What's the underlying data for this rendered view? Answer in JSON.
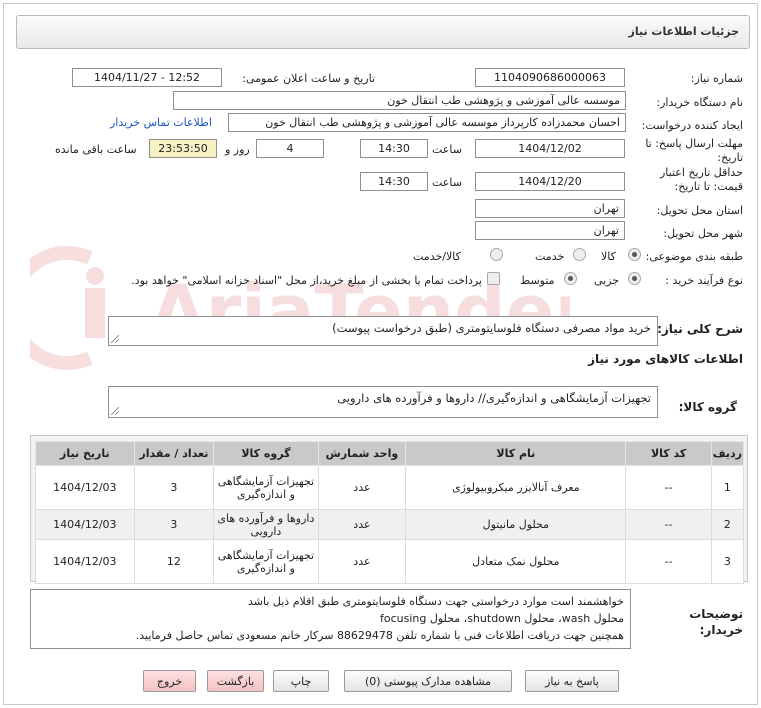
{
  "page": {
    "title": "جزئیات اطلاعات نیاز"
  },
  "form": {
    "need_number_label": "شماره نیاز:",
    "need_number": "1104090686000063",
    "announce_label": "تاریخ و ساعت اعلان عمومی:",
    "announce_value": "1404/11/27 - 12:52",
    "buyer_label": "نام دستگاه خریدار:",
    "buyer_value": "موسسه عالی آموزشی و پژوهشی طب انتقال خون",
    "creator_label": "ایجاد کننده درخواست:",
    "creator_value": "احسان محمدزاده کارپرداز موسسه عالی آموزشی و پژوهشی طب انتقال خون",
    "contact_link": "اطلاعات تماس خریدار",
    "deadline_label": "مهلت ارسال پاسخ: تا تاریخ:",
    "deadline_date": "1404/12/02",
    "time_label": "ساعت",
    "deadline_time": "14:30",
    "days_value": "4",
    "days_label": "روز و",
    "remaining_value": "23:53:50",
    "remaining_label": "ساعت باقی مانده",
    "validity_label": "حداقل تاریخ اعتبار قیمت: تا تاریخ:",
    "validity_date": "1404/12/20",
    "validity_time": "14:30",
    "province_label": "استان محل تحویل:",
    "province_value": "تهران",
    "city_label": "شهر محل تحویل:",
    "city_value": "تهران",
    "category_label": "طبقه بندی موضوعی:",
    "category_options": [
      "کالا",
      "خدمت",
      "کالا/خدمت"
    ],
    "category_selected": "کالا",
    "process_label": "نوع فرآیند خرید :",
    "process_options": [
      "جزیی",
      "متوسط"
    ],
    "process_selected": "جزیی",
    "payment_note": "پرداخت تمام یا بخشی از مبلغ خرید،از محل \"اسناد خزانه اسلامی\" خواهد بود.",
    "summary_label": "شرح کلی نیاز:",
    "summary_value": "خرید مواد مصرفی دستگاه فلوسایتومتری (طبق درخواست پیوست)",
    "goods_info_label": "اطلاعات کالاهای مورد نیاز",
    "goods_group_label": "گروه کالا:",
    "goods_group_value": "تجهیزات آزمایشگاهی و اندازه‌گیری// داروها و فرآورده های دارویی"
  },
  "table": {
    "headers": [
      "ردیف",
      "کد کالا",
      "نام کالا",
      "واحد شمارش",
      "گروه کالا",
      "تعداد / مقدار",
      "تاریخ نیاز"
    ],
    "rows": [
      {
        "row": "1",
        "code": "--",
        "name": "معرف آنالایزر میکروبیولوژی",
        "unit": "عدد",
        "group": "تجهیزات آزمایشگاهی و اندازه‌گیری",
        "qty": "3",
        "date": "1404/12/03"
      },
      {
        "row": "2",
        "code": "--",
        "name": "محلول مانیتول",
        "unit": "عدد",
        "group": "داروها و فرآورده های دارویی",
        "qty": "3",
        "date": "1404/12/03"
      },
      {
        "row": "3",
        "code": "--",
        "name": "محلول نمک متعادل",
        "unit": "عدد",
        "group": "تجهیزات آزمایشگاهی و اندازه‌گیری",
        "qty": "12",
        "date": "1404/12/03"
      }
    ]
  },
  "buyer_notes": {
    "label": "توضیحات خریدار:",
    "line1": "خواهشمند است موارد درخواستی جهت دستگاه فلوسایتومتری طبق اقلام ذیل باشد",
    "line2": "محلول wash، محلول shutdown، محلول focusing",
    "line3": "همچنین جهت دریافت اطلاعات فنی با شماره تلفن 88629478 سرکار خانم مسعودی تماس حاصل فرمایید."
  },
  "buttons": {
    "reply": "پاسخ به نیاز",
    "attachments": "مشاهده مدارک پیوستی (0)",
    "print": "چاپ",
    "back": "بازگشت",
    "exit": "خروج"
  },
  "colors": {
    "link": "#1a55c6",
    "remaining_bg": "#f6f1c3",
    "watermark": "#e9a3a3",
    "header_bg": "#c9c9c9"
  },
  "watermark": {
    "text": "AriaTender.neT"
  }
}
